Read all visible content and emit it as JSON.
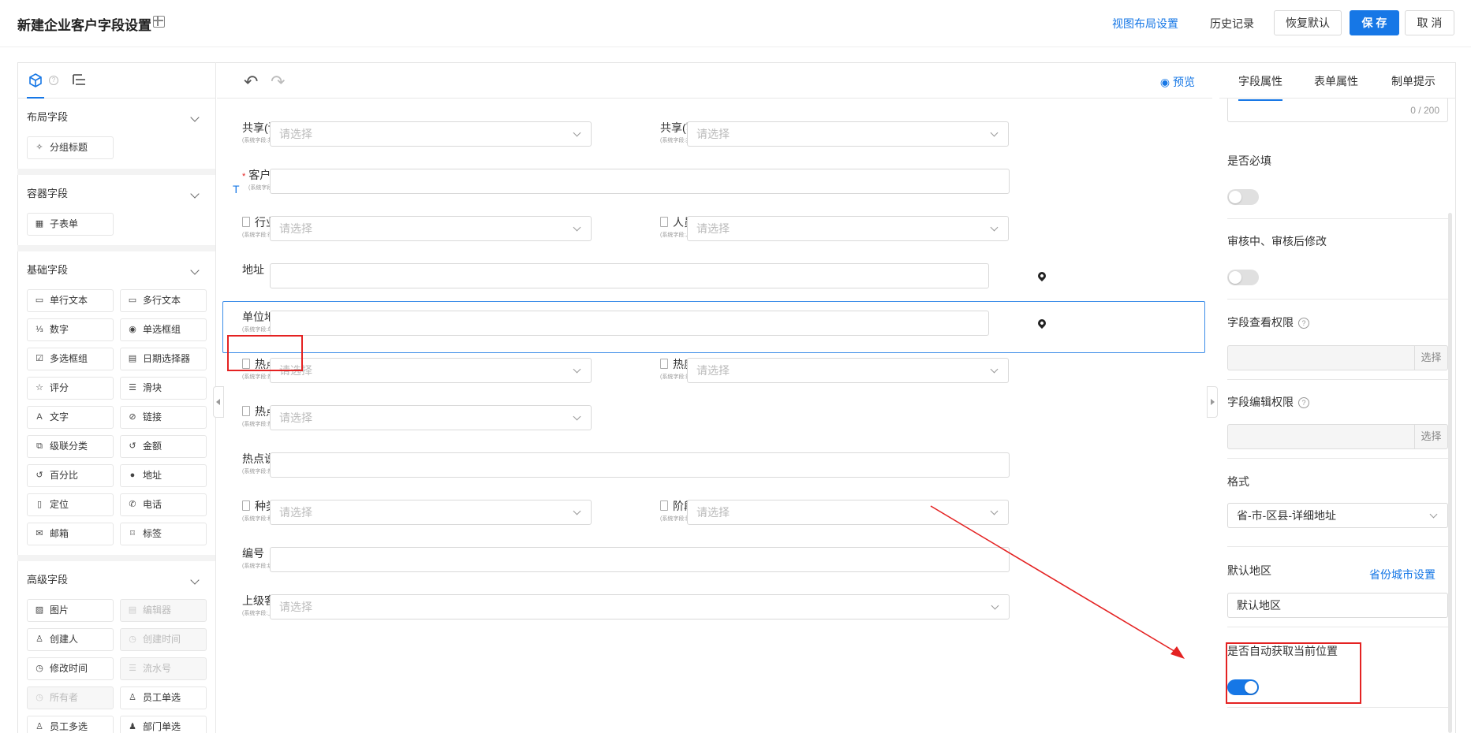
{
  "header": {
    "title": "新建企业客户字段设置",
    "view_layout": "视图布局设置",
    "history": "历史记录",
    "restore_default": "恢复默认",
    "save": "保 存",
    "cancel": "取 消"
  },
  "left_panel": {
    "sections": [
      {
        "title": "布局字段",
        "items": [
          {
            "label": "分组标题",
            "icon": "group-title-icon",
            "glyph": "✧",
            "disabled": false
          }
        ]
      },
      {
        "title": "容器字段",
        "items": [
          {
            "label": "子表单",
            "icon": "table-icon",
            "glyph": "▦",
            "disabled": false
          }
        ]
      },
      {
        "title": "基础字段",
        "items": [
          {
            "label": "单行文本",
            "icon": "single-line-icon",
            "glyph": "▭",
            "disabled": false
          },
          {
            "label": "多行文本",
            "icon": "multi-line-icon",
            "glyph": "▭",
            "disabled": false
          },
          {
            "label": "数字",
            "icon": "number-icon",
            "glyph": "⅓",
            "disabled": false
          },
          {
            "label": "单选框组",
            "icon": "radio-icon",
            "glyph": "◉",
            "disabled": false
          },
          {
            "label": "多选框组",
            "icon": "checkbox-icon",
            "glyph": "☑",
            "disabled": false
          },
          {
            "label": "日期选择器",
            "icon": "calendar-icon",
            "glyph": "▤",
            "disabled": false
          },
          {
            "label": "评分",
            "icon": "star-icon",
            "glyph": "☆",
            "disabled": false
          },
          {
            "label": "滑块",
            "icon": "slider-icon",
            "glyph": "☰",
            "disabled": false
          },
          {
            "label": "文字",
            "icon": "text-icon",
            "glyph": "A",
            "disabled": false
          },
          {
            "label": "链接",
            "icon": "link-icon",
            "glyph": "⊘",
            "disabled": false
          },
          {
            "label": "级联分类",
            "icon": "cascade-icon",
            "glyph": "⧉",
            "disabled": false
          },
          {
            "label": "金额",
            "icon": "amount-icon",
            "glyph": "↺",
            "disabled": false
          },
          {
            "label": "百分比",
            "icon": "percent-icon",
            "glyph": "↺",
            "disabled": false
          },
          {
            "label": "地址",
            "icon": "location-pin-icon",
            "glyph": "●",
            "disabled": false
          },
          {
            "label": "定位",
            "icon": "position-icon",
            "glyph": "▯",
            "disabled": false
          },
          {
            "label": "电话",
            "icon": "phone-icon",
            "glyph": "✆",
            "disabled": false
          },
          {
            "label": "邮箱",
            "icon": "mail-icon",
            "glyph": "✉",
            "disabled": false
          },
          {
            "label": "标签",
            "icon": "bookmark-icon",
            "glyph": "⌑",
            "disabled": false
          }
        ]
      },
      {
        "title": "高级字段",
        "items": [
          {
            "label": "图片",
            "icon": "image-icon",
            "glyph": "▨",
            "disabled": false
          },
          {
            "label": "编辑器",
            "icon": "editor-icon",
            "glyph": "▤",
            "disabled": true
          },
          {
            "label": "创建人",
            "icon": "user-icon",
            "glyph": "♙",
            "disabled": false
          },
          {
            "label": "创建时间",
            "icon": "clock-icon",
            "glyph": "◷",
            "disabled": true
          },
          {
            "label": "修改时间",
            "icon": "clock-icon",
            "glyph": "◷",
            "disabled": false
          },
          {
            "label": "流水号",
            "icon": "serial-icon",
            "glyph": "☰",
            "disabled": true
          },
          {
            "label": "所有者",
            "icon": "owner-icon",
            "glyph": "◷",
            "disabled": true
          },
          {
            "label": "员工单选",
            "icon": "employee-icon",
            "glyph": "♙",
            "disabled": false
          },
          {
            "label": "员工多选",
            "icon": "employees-icon",
            "glyph": "♙",
            "disabled": false
          },
          {
            "label": "部门单选",
            "icon": "dept-icon",
            "glyph": "♟",
            "disabled": false
          }
        ]
      }
    ]
  },
  "canvas": {
    "preview": "预览",
    "placeholder": "请选择",
    "rows": [
      {
        "label": "共享(读)",
        "sub": "(系统字段:共享(读))",
        "type": "select",
        "pair": {
          "label": "共享(写)",
          "sub": "(系统字段:共享(写))"
        }
      },
      {
        "label": "客户名称",
        "sub": "(系统字段:客户名称)",
        "type": "input",
        "required": true
      },
      {
        "label": "行业",
        "sub": "(系统字段:行业)",
        "type": "select",
        "doc": true,
        "pair": {
          "label": "人员规模",
          "sub": "(系统字段:人员规模)",
          "doc": true
        }
      },
      {
        "label": "地址",
        "sub": "",
        "type": "address"
      },
      {
        "label": "单位地址",
        "sub": "(系统字段:单位地址)",
        "type": "address",
        "selected": true
      },
      {
        "label": "热点客户",
        "sub": "(系统字段:热点客户)",
        "type": "select",
        "doc": true,
        "pair": {
          "label": "热度",
          "sub": "(系统字段:热度)",
          "doc": true
        }
      },
      {
        "label": "热点分类",
        "sub": "(系统字段:热点分类)",
        "type": "select-half",
        "doc": true
      },
      {
        "label": "热点说明",
        "sub": "(系统字段:热点说明)",
        "type": "input"
      },
      {
        "label": "种类",
        "sub": "(系统字段:种类)",
        "type": "select",
        "doc": true,
        "pair": {
          "label": "阶段",
          "sub": "(系统字段:阶段)",
          "doc": true
        }
      },
      {
        "label": "编号",
        "sub": "(系统字段:编号)",
        "type": "input"
      },
      {
        "label": "上级客户",
        "sub": "(系统字段:上级客户)",
        "type": "select-full"
      }
    ]
  },
  "right_panel": {
    "tabs": [
      "字段属性",
      "表单属性",
      "制单提示"
    ],
    "char_count": "0 / 200",
    "required_label": "是否必填",
    "review_edit_label": "审核中、审核后修改",
    "view_perm_label": "字段查看权限",
    "edit_perm_label": "字段编辑权限",
    "select_btn": "选择",
    "format_label": "格式",
    "format_value": "省-市-区县-详细地址",
    "default_region_label": "默认地区",
    "province_city_link": "省份城市设置",
    "default_region_value": "默认地区",
    "auto_locate_label": "是否自动获取当前位置",
    "auto_locate_on": true
  },
  "colors": {
    "accent": "#1677e6",
    "annotation": "#e42222"
  }
}
